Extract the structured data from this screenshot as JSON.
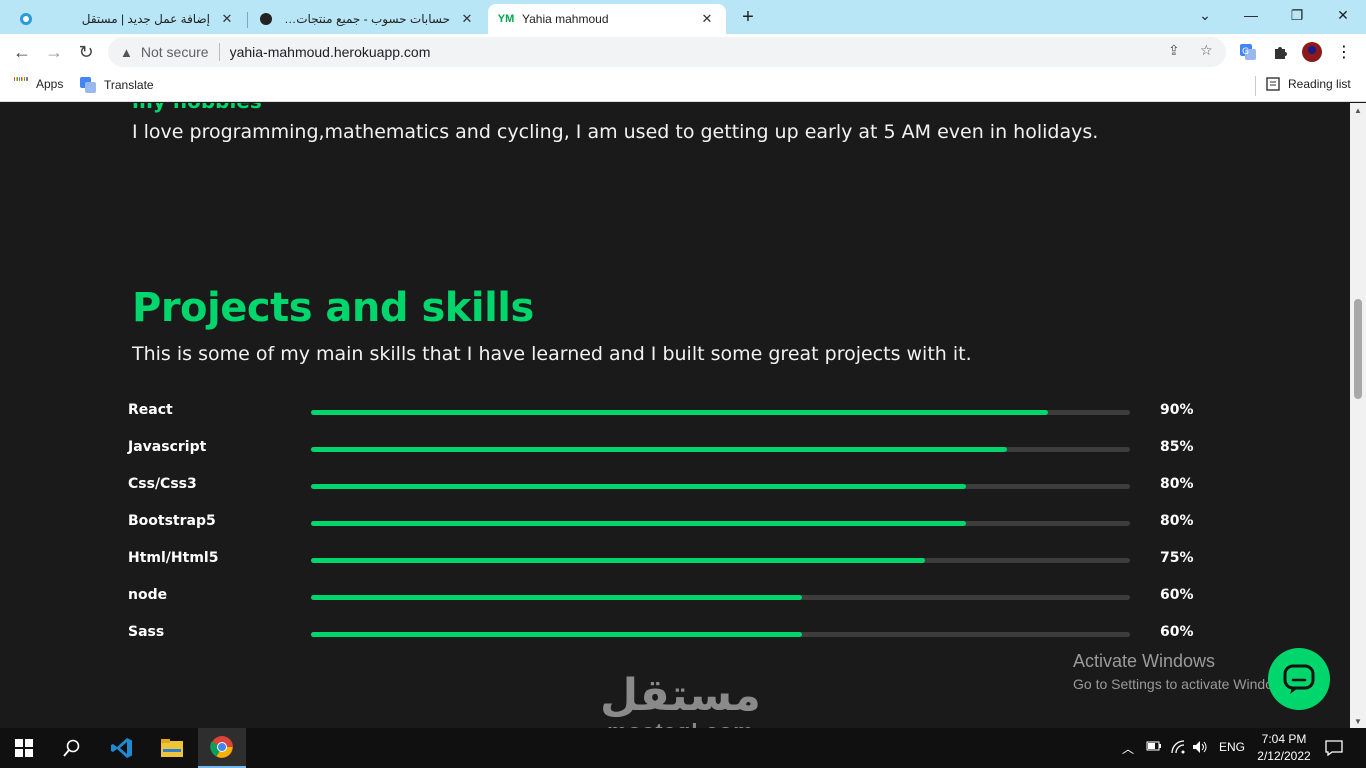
{
  "browser": {
    "tabs": [
      {
        "title": "إضافة عمل جديد | مستقل",
        "favicon": "mostaql-icon"
      },
      {
        "title": "حسابات حسوب - جميع منتجات حسوب",
        "favicon": "hsoub-icon"
      },
      {
        "title": "Yahia mahmoud",
        "favicon": "ym-logo-icon",
        "active": true
      }
    ],
    "security_label": "Not secure",
    "url": "yahia-mahmoud.herokuapp.com",
    "bookmarks": [
      {
        "label": "Apps"
      },
      {
        "label": "Translate"
      }
    ],
    "reading_list": "Reading list"
  },
  "page": {
    "hobbies_heading": "my hobbies",
    "hobbies_text": "I love programming,mathematics and cycling, I am used to getting up early at 5 AM even in holidays.",
    "projects_title": "Projects and skills",
    "projects_subtitle": "This is some of my main skills that I have learned and I built some great projects with it.",
    "skills": [
      {
        "name": "React",
        "percent": 90,
        "label": "90%"
      },
      {
        "name": "Javascript",
        "percent": 85,
        "label": "85%"
      },
      {
        "name": "Css/Css3",
        "percent": 80,
        "label": "80%"
      },
      {
        "name": "Bootstrap5",
        "percent": 80,
        "label": "80%"
      },
      {
        "name": "Html/Html5",
        "percent": 75,
        "label": "75%"
      },
      {
        "name": "node",
        "percent": 60,
        "label": "60%"
      },
      {
        "name": "Sass",
        "percent": 60,
        "label": "60%"
      }
    ]
  },
  "overlay": {
    "activate_title": "Activate Windows",
    "activate_sub": "Go to Settings to activate Windows.",
    "watermark_ar": "مستقل",
    "watermark_en": "mostaql.com"
  },
  "taskbar": {
    "lang": "ENG",
    "time": "7:04 PM",
    "date": "2/12/2022"
  },
  "colors": {
    "accent": "#00d66b",
    "page_bg": "#1a1a1a",
    "tabstrip_bg": "#b8e6f6"
  }
}
